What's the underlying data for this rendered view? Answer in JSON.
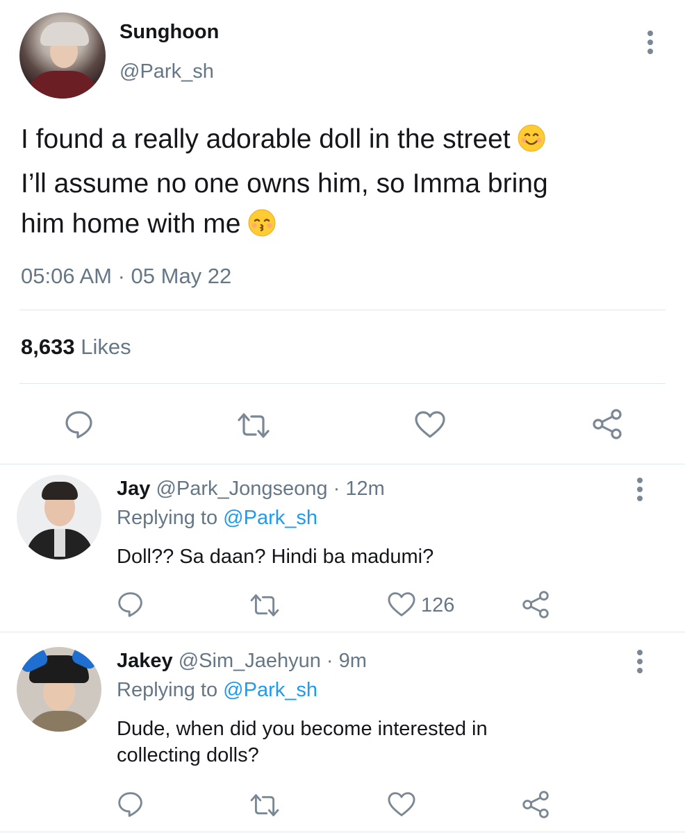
{
  "main_tweet": {
    "display_name": "Sunghoon",
    "handle": "@Park_sh",
    "text_lines": [
      "I found a really adorable doll in the street",
      "I’ll assume no one owns him, so Imma bring",
      "him home with me"
    ],
    "timestamp": "05:06 AM · 05 May 22",
    "likes_count": "8,633",
    "likes_label": "Likes"
  },
  "replies": [
    {
      "display_name": "Jay",
      "meta": "@Park_Jongseong · 12m",
      "replying_prefix": "Replying to",
      "replying_handle": "@Park_sh",
      "text_lines": [
        "Doll?? Sa daan? Hindi ba madumi?"
      ],
      "like_count": "126"
    },
    {
      "display_name": "Jakey",
      "meta": "@Sim_Jaehyun · 9m",
      "replying_prefix": "Replying to",
      "replying_handle": "@Park_sh",
      "text_lines": [
        "Dude, when did you become interested in",
        "collecting dolls?"
      ],
      "like_count": ""
    }
  ],
  "colors": {
    "link": "#1d9bf0",
    "secondary": "#657786",
    "divider": "#e1e8ed",
    "icon": "#7a8794"
  },
  "icons": [
    "more-icon",
    "smile-emoji",
    "kiss-emoji",
    "reply-icon",
    "retweet-icon",
    "heart-icon",
    "share-icon"
  ]
}
